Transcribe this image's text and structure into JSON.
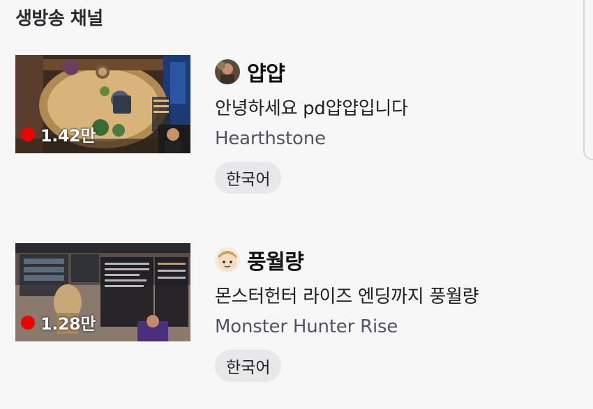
{
  "section": {
    "title": "생방송 채널"
  },
  "channels": [
    {
      "name": "얍얍",
      "viewers": "1.42만",
      "title": "안녕하세요 pd얍얍입니다",
      "game": "Hearthstone",
      "tag": "한국어",
      "avatar_icon": "streamer-avatar-icon",
      "live_color": "#eb0400"
    },
    {
      "name": "풍월량",
      "viewers": "1.28만",
      "title": "몬스터헌터 라이즈   엔딩까지 풍월량",
      "game": "Monster Hunter Rise",
      "tag": "한국어",
      "avatar_icon": "cartoon-avatar-icon",
      "live_color": "#eb0400"
    }
  ]
}
